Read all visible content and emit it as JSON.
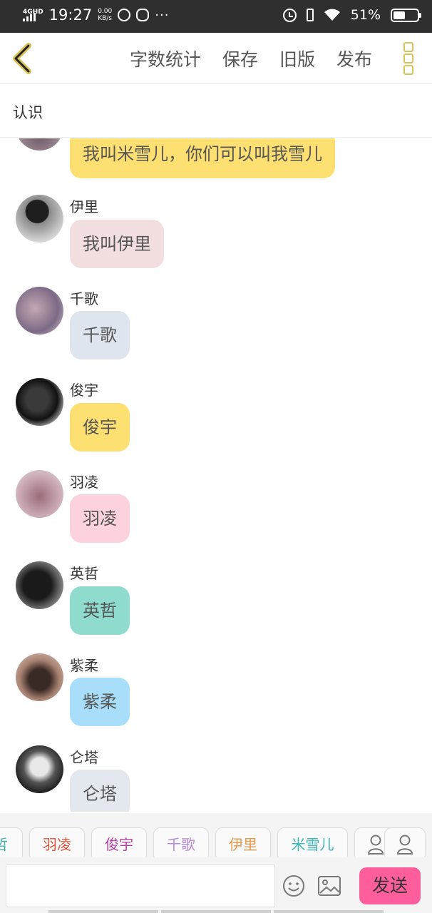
{
  "status_bar": {
    "network": "4G",
    "network_hd": "HD",
    "time": "19:27",
    "speed_value": "0.00",
    "speed_unit": "KB/s",
    "more": "···",
    "battery_pct": "51%",
    "battery_level": 0.51
  },
  "toolbar": {
    "word_count": "字数统计",
    "save": "保存",
    "old_version": "旧版",
    "publish": "发布",
    "accent_color": "#d8c25a"
  },
  "chat": {
    "title": "认识"
  },
  "messages": [
    {
      "sender": "",
      "text": "我叫米雪儿，你们可以叫我雪儿",
      "bubble_color": "#fddf72"
    },
    {
      "sender": "伊里",
      "text": "我叫伊里",
      "bubble_color": "#f3dfe0"
    },
    {
      "sender": "千歌",
      "text": "千歌",
      "bubble_color": "#dfe5ee"
    },
    {
      "sender": "俊宇",
      "text": "俊宇",
      "bubble_color": "#fddf72"
    },
    {
      "sender": "羽凌",
      "text": "羽凌",
      "bubble_color": "#fcd2df"
    },
    {
      "sender": "英哲",
      "text": "英哲",
      "bubble_color": "#8fdccf"
    },
    {
      "sender": "紫柔",
      "text": "紫柔",
      "bubble_color": "#a8def9"
    },
    {
      "sender": "仑塔",
      "text": "仑塔",
      "bubble_color": "#e3e7ee"
    }
  ],
  "roles": [
    {
      "label": "哲",
      "color": "#3fb0a5"
    },
    {
      "label": "羽凌",
      "color": "#e0513a"
    },
    {
      "label": "俊宇",
      "color": "#b53ea3"
    },
    {
      "label": "千歌",
      "color": "#b58ad4"
    },
    {
      "label": "伊里",
      "color": "#e3994c"
    },
    {
      "label": "米雪儿",
      "color": "#3fb6b8"
    }
  ],
  "input": {
    "placeholder": "",
    "send_label": "发送",
    "send_color": "#ff5e9c"
  }
}
